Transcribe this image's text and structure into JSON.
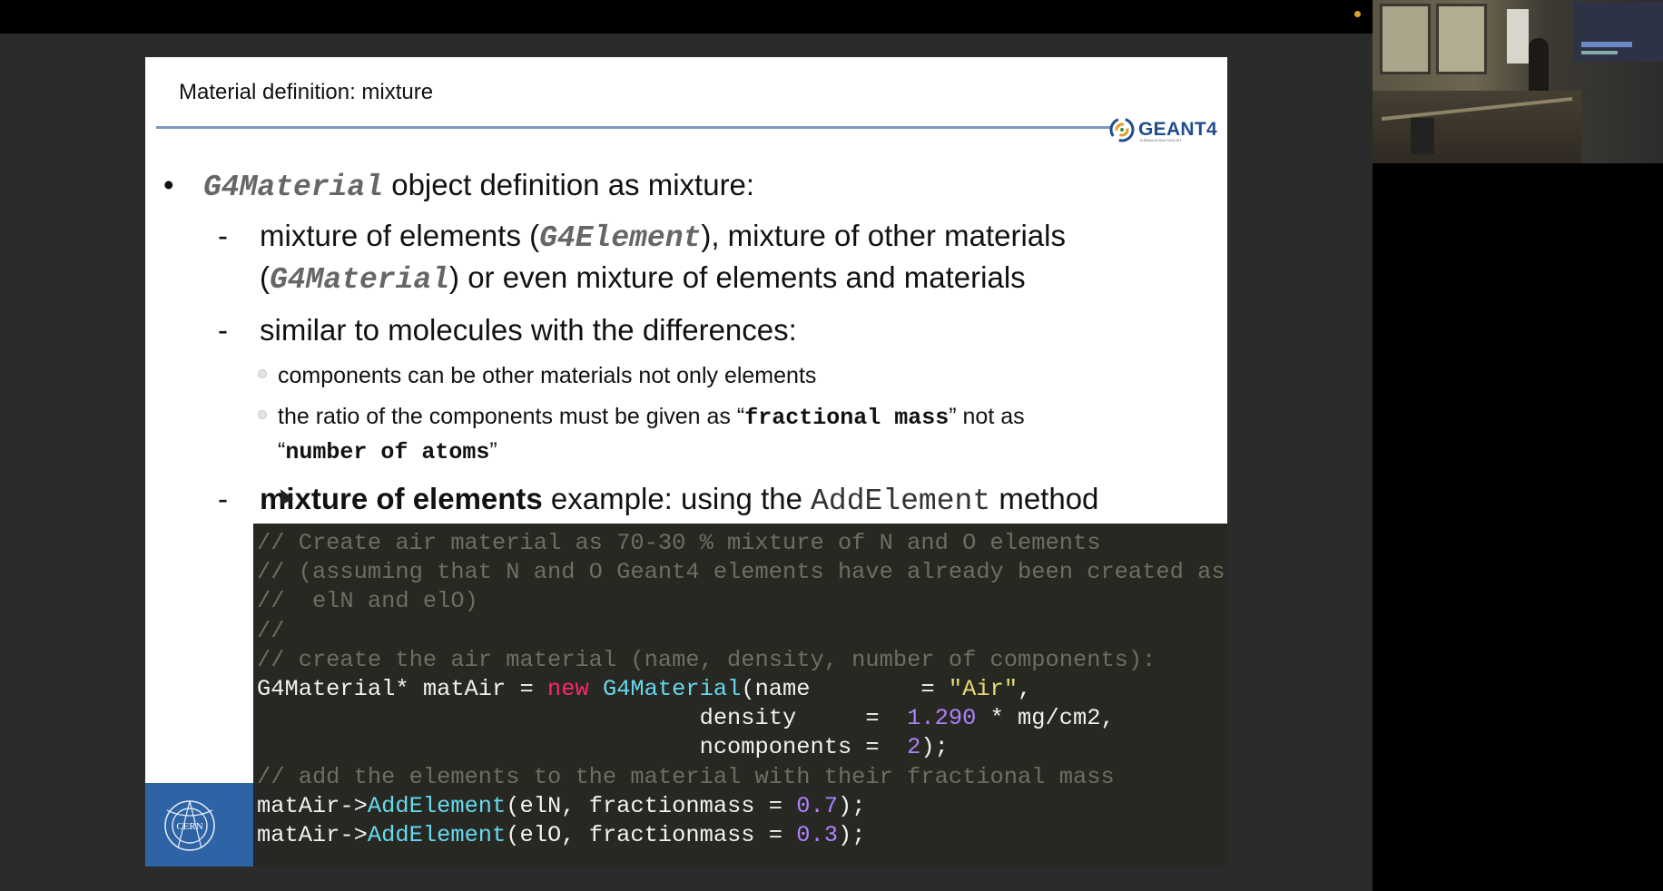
{
  "slide": {
    "title": "Material definition: mixture",
    "logo_text": "GEANT4",
    "logo_subtext": "A SIMULATION TOOLKIT",
    "bullet1_code": "G4Material",
    "bullet1_text": " object definition as mixture:",
    "sub1_a": "mixture of elements (",
    "sub1_code1": "G4Element",
    "sub1_b": "), mixture of other materials",
    "sub1_c": "(",
    "sub1_code2": "G4Material",
    "sub1_d": ") or even mixture of elements and materials",
    "sub2": "similar to molecules with the differences:",
    "sub2_item1": "components can be other materials not only elements",
    "sub2_item2_a": "the ratio of the components must be given as “",
    "sub2_item2_code1": "fractional mass",
    "sub2_item2_b": "” not as",
    "sub2_item2_c": "“",
    "sub2_item2_code2": "number of atoms",
    "sub2_item2_d": "”",
    "sub3_bold": "mixture of elements",
    "sub3_text": " example: using the ",
    "sub3_code": "AddElement",
    "sub3_end": " method",
    "dash": "-",
    "bullet": "•",
    "cern_label": "CERN"
  },
  "code": {
    "c1": "// Create air material as 70-30 % mixture of N and O elements",
    "c2": "// (assuming that N and O Geant4 elements have already been created as",
    "c3": "//  elN and elO)",
    "c4": "//",
    "c5": "// create the air material (name, density, number of components):",
    "l6_a": "G4Material* matAir = ",
    "l6_kw": "new",
    "l6_sp": " ",
    "l6_ty": "G4Material",
    "l6_b": "(name        = ",
    "l6_str": "\"Air\"",
    "l6_c": ",",
    "l7_a": "                                density     =  ",
    "l7_num": "1.290",
    "l7_b": " * mg/cm2,",
    "l8_a": "                                ncomponents =  ",
    "l8_num": "2",
    "l8_b": ");",
    "c9": "// add the elements to the material with their fractional mass",
    "l10_a": "matAir->",
    "l10_fn": "AddElement",
    "l10_b": "(elN, fractionmass = ",
    "l10_num": "0.7",
    "l10_c": ");",
    "l11_a": "matAir->",
    "l11_fn": "AddElement",
    "l11_b": "(elO, fractionmass = ",
    "l11_num": "0.3",
    "l11_c": ");"
  },
  "colors": {
    "code_bg": "#272822",
    "comment": "#6e6e60",
    "keyword": "#f92672",
    "type": "#66d9ef",
    "string": "#e6db74",
    "number": "#ae81ff",
    "title_rule": "#7d97bd",
    "cern_blue": "#2e63a5"
  },
  "icons": {
    "geant4_logo": "geant4-swirl-icon",
    "cern_logo": "cern-logo-icon",
    "recording": "recording-dot-icon"
  }
}
